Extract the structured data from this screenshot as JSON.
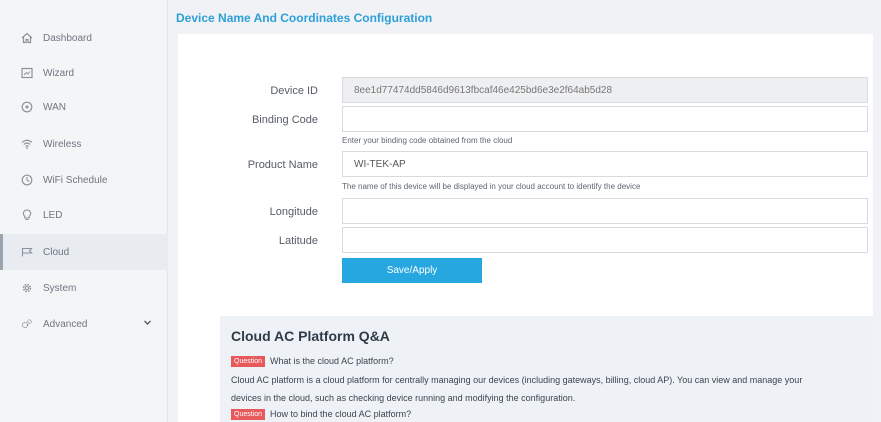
{
  "sidebar": {
    "items": [
      {
        "label": "Dashboard",
        "icon": "dashboard-icon"
      },
      {
        "label": "Wizard",
        "icon": "wizard-icon"
      },
      {
        "label": "WAN",
        "icon": "wan-icon"
      },
      {
        "label": "Wireless",
        "icon": "wireless-icon"
      },
      {
        "label": "WiFi Schedule",
        "icon": "clock-icon"
      },
      {
        "label": "LED",
        "icon": "led-icon"
      },
      {
        "label": "Cloud",
        "icon": "cloud-icon",
        "active": true
      },
      {
        "label": "System",
        "icon": "gear-icon"
      },
      {
        "label": "Advanced",
        "icon": "advanced-icon",
        "caret": "chevron-down-icon"
      }
    ]
  },
  "page": {
    "title": "Device Name And Coordinates Configuration"
  },
  "form": {
    "device_id": {
      "label": "Device ID",
      "value": "8ee1d77474dd5846d9613fbcaf46e425bd6e3e2f64ab5d28"
    },
    "binding_code": {
      "label": "Binding Code",
      "value": "",
      "help": "Enter your binding code obtained from the cloud"
    },
    "product_name": {
      "label": "Product Name",
      "value": "WI-TEK-AP",
      "help": "The name of this device will be displayed in your cloud account to identify the device"
    },
    "longitude": {
      "label": "Longitude",
      "value": ""
    },
    "latitude": {
      "label": "Latitude",
      "value": ""
    },
    "submit_label": "Save/Apply"
  },
  "qa": {
    "title": "Cloud AC Platform Q&A",
    "badge": "Question",
    "q1": "What is the cloud AC platform?",
    "a1_line1": "Cloud AC platform is a cloud platform for centrally managing our devices (including gateways, billing, cloud AP). You can view and manage your",
    "a1_line2": "devices in the cloud, such as checking device running and modifying the configuration.",
    "q2": "How to bind the cloud AC platform?"
  },
  "colors": {
    "accent": "#2d9fd9",
    "button": "#26a7e0",
    "question_badge": "#e8595c"
  }
}
